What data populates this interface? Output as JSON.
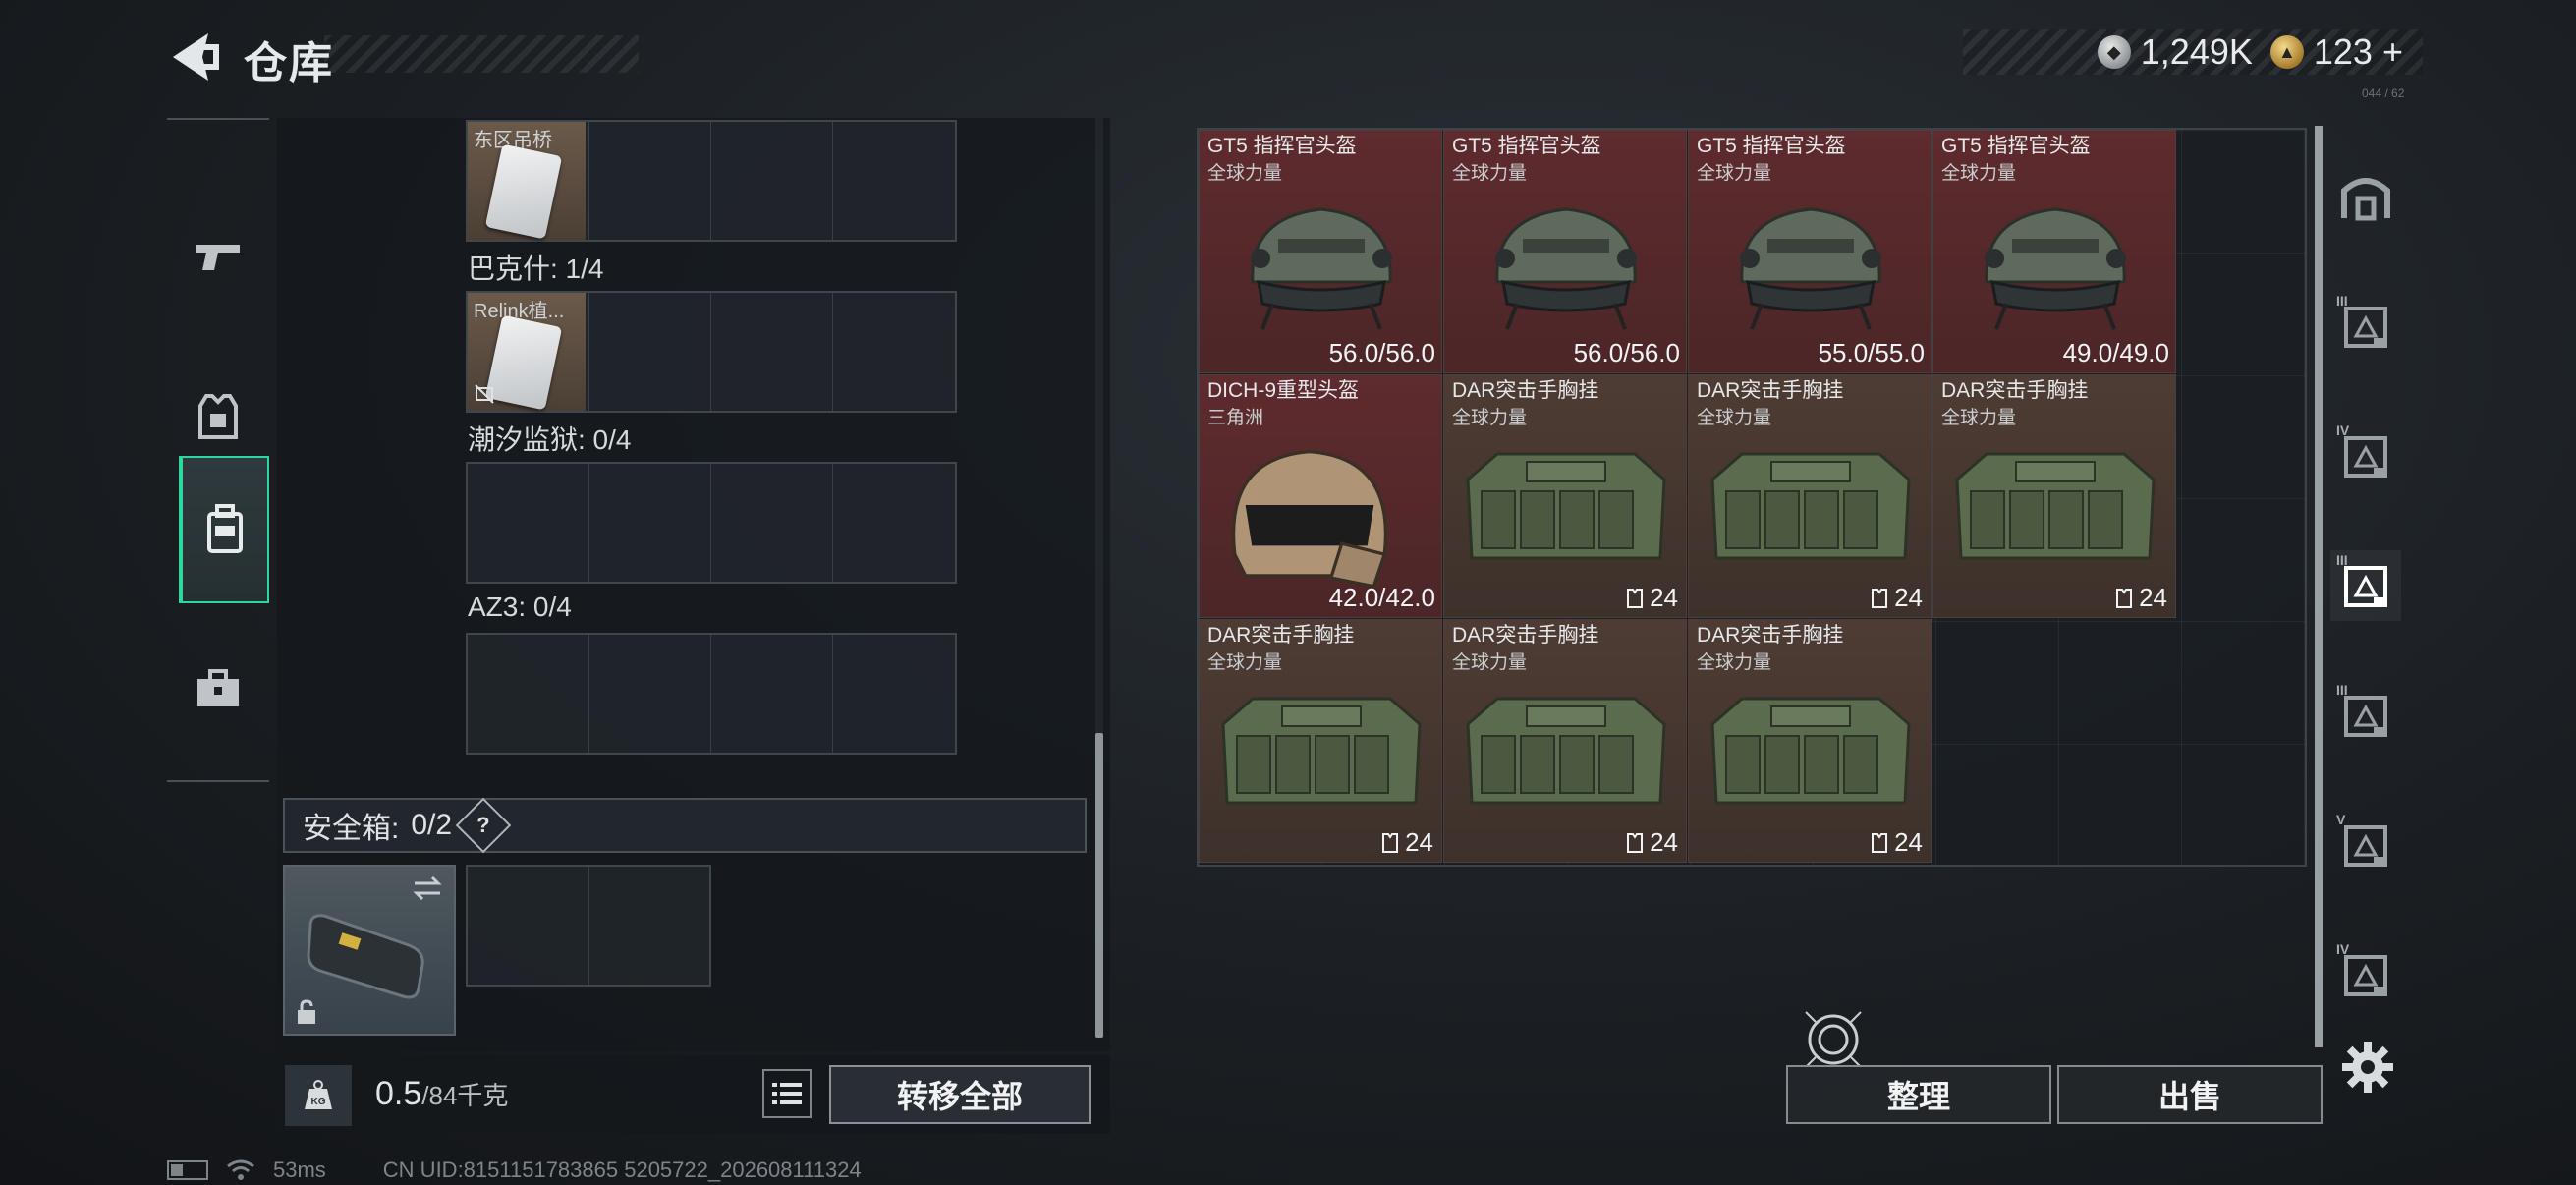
{
  "header": {
    "title": "仓库",
    "back_icon": "back-arrow-icon"
  },
  "currency": {
    "silver_amount": "1,249K",
    "gold_amount": "123",
    "gold_add": "+",
    "silver_color": "#b9bec2",
    "gold_color": "#c9a04a"
  },
  "version_tag": "044 / 62",
  "categories": [
    {
      "name": "weapons",
      "icon": "pistol-icon",
      "active": false
    },
    {
      "name": "armor",
      "icon": "armor-vest-icon",
      "active": false
    },
    {
      "name": "backpack",
      "icon": "backpack-icon",
      "active": true
    },
    {
      "name": "toolbox",
      "icon": "toolbox-icon",
      "active": false
    }
  ],
  "key_rows": [
    {
      "label": "",
      "key_name": "东区吊桥"
    },
    {
      "label": "巴克什: 1/4",
      "key_name": "Relink植..."
    },
    {
      "label": "潮汐监狱: 0/4",
      "key_name": ""
    },
    {
      "label": "AZ3: 0/4",
      "key_name": ""
    }
  ],
  "safebox": {
    "label": "安全箱:",
    "count": "0/2",
    "help": "?"
  },
  "weight": {
    "value": "0.5",
    "unit": "/84千克"
  },
  "buttons": {
    "transfer_all": "转移全部",
    "sort": "整理",
    "sell": "出售"
  },
  "stash_items": [
    {
      "name": "GT5 指挥官头盔",
      "sub": "全球力量",
      "value": "56.0/56.0",
      "kind": "helmet",
      "rarity": "red"
    },
    {
      "name": "GT5 指挥官头盔",
      "sub": "全球力量",
      "value": "56.0/56.0",
      "kind": "helmet",
      "rarity": "red"
    },
    {
      "name": "GT5 指挥官头盔",
      "sub": "全球力量",
      "value": "55.0/55.0",
      "kind": "helmet",
      "rarity": "red"
    },
    {
      "name": "GT5 指挥官头盔",
      "sub": "全球力量",
      "value": "49.0/49.0",
      "kind": "helmet",
      "rarity": "red"
    },
    {
      "name": "DICH-9重型头盔",
      "sub": "三角洲",
      "value": "42.0/42.0",
      "kind": "heavy-helmet",
      "rarity": "red"
    },
    {
      "name": "DAR突击手胸挂",
      "sub": "全球力量",
      "count": "24",
      "kind": "vest",
      "rarity": "brown"
    },
    {
      "name": "DAR突击手胸挂",
      "sub": "全球力量",
      "count": "24",
      "kind": "vest",
      "rarity": "brown"
    },
    {
      "name": "DAR突击手胸挂",
      "sub": "全球力量",
      "count": "24",
      "kind": "vest",
      "rarity": "brown"
    },
    {
      "name": "DAR突击手胸挂",
      "sub": "全球力量",
      "count": "24",
      "kind": "vest",
      "rarity": "brown"
    },
    {
      "name": "DAR突击手胸挂",
      "sub": "全球力量",
      "count": "24",
      "kind": "vest",
      "rarity": "brown"
    },
    {
      "name": "DAR突击手胸挂",
      "sub": "全球力量",
      "count": "24",
      "kind": "vest",
      "rarity": "brown"
    }
  ],
  "right_tabs": [
    {
      "level": "",
      "icon": "stash-home-icon"
    },
    {
      "level": "III",
      "icon": "tier3-armor-icon"
    },
    {
      "level": "IV",
      "icon": "tier4-folder-icon"
    },
    {
      "level": "III",
      "icon": "tier3-armor-active-icon"
    },
    {
      "level": "III",
      "icon": "tier3-weapon-icon"
    },
    {
      "level": "V",
      "icon": "tier5-case-icon"
    },
    {
      "level": "IV",
      "icon": "tier4-medkit-icon"
    }
  ],
  "footer": {
    "ping": "53ms",
    "uid": "CN UID:8151151783865 5205722_202608111324"
  }
}
